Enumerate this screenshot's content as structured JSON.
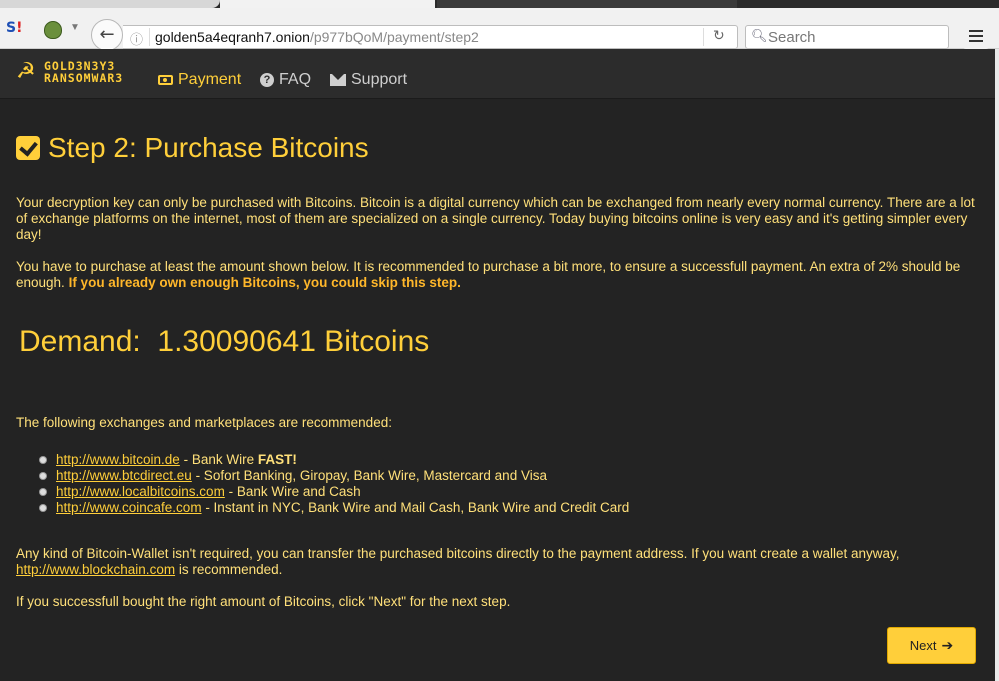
{
  "browser": {
    "url_host": "golden5a4eqranh7.onion",
    "url_path": "/p977bQoM/payment/step2",
    "search_placeholder": "Search",
    "back_icon": "back-arrow-icon",
    "reload_icon": "reload-icon",
    "menu_icon": "hamburger-menu-icon"
  },
  "nav": {
    "payment": "Payment",
    "faq": "FAQ",
    "support": "Support",
    "logo_text_1": "GOLD3N3Y3",
    "logo_text_2": "RANSOMWAR3"
  },
  "step": {
    "title": "Step 2: Purchase Bitcoins"
  },
  "body": {
    "p1": "Your decryption key can only be purchased with Bitcoins. Bitcoin is a digital currency which can be exchanged from nearly every normal currency. There are a lot of exchange platforms on the internet, most of them are specialized on a single currency. Today buying bitcoins online is very easy and it's getting simpler every day!",
    "p2_text": "You have to purchase at least the amount shown below. It is recommended to purchase a bit more, to ensure a successfull payment. An extra of 2% should be enough. ",
    "p2_bold": "If you already own enough Bitcoins, you could skip this step.",
    "demand_label": "Demand:",
    "demand_amount": "1.30090641 Bitcoins",
    "p3": "The following exchanges and marketplaces are recommended:",
    "exchanges": [
      {
        "link": "http://www.bitcoin.de",
        "desc": " - Bank Wire ",
        "extra": "FAST!"
      },
      {
        "link": "http://www.btcdirect.eu",
        "desc": " - Sofort Banking, Giropay, Bank Wire, Mastercard and Visa",
        "extra": ""
      },
      {
        "link": "http://www.localbitcoins.com",
        "desc": " - Bank Wire and Cash",
        "extra": ""
      },
      {
        "link": "http://www.coincafe.com",
        "desc": " - Instant in NYC, Bank Wire and Mail Cash, Bank Wire and Credit Card",
        "extra": ""
      }
    ],
    "p4_text": "Any kind of Bitcoin-Wallet isn't required, you can transfer the purchased bitcoins directly to the payment address. If you want create a wallet anyway, ",
    "p4_link": "http://www.blockchain.com",
    "p4_tail": " is recommended.",
    "p5": "If you successfull bought the right amount of Bitcoins, click \"Next\" for the next step."
  },
  "actions": {
    "next": "Next"
  }
}
